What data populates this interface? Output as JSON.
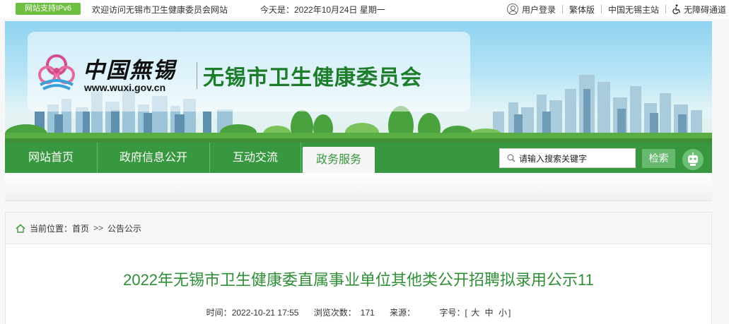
{
  "topbar": {
    "ipv6_badge": "网站支持IPv6",
    "welcome": "欢迎访问无锡市卫生健康委员会网站",
    "today": "今天是：2022年10月24日  星期一",
    "links": {
      "login": "用户登录",
      "traditional": "繁体版",
      "main_site": "中国无锡主站",
      "accessibility": "无障碍通道"
    }
  },
  "banner": {
    "logo_text": "中国無锡",
    "logo_url": "www.wuxi.gov.cn",
    "site_title": "无锡市卫生健康委员会"
  },
  "nav": {
    "items": [
      "网站首页",
      "政府信息公开",
      "互动交流",
      "政务服务"
    ],
    "active": "政务服务",
    "search_placeholder": "请输入搜索关键字",
    "search_button": "检索"
  },
  "breadcrumb": {
    "label": "当前位置：",
    "home": "首页",
    "separator": ">>",
    "current": "公告公示"
  },
  "article": {
    "title": "2022年无锡市卫生健康委直属事业单位其他类公开招聘拟录用公示11",
    "time_label": "时间：",
    "time": "2022-10-21 17:55",
    "views_label": "浏览次数：",
    "views": "171",
    "source_label": "来源：",
    "font_label": "字号：",
    "font_open": "[",
    "font_large": "大",
    "font_medium": "中",
    "font_small": "小",
    "font_close": "]"
  },
  "colors": {
    "brand_green": "#37983f",
    "title_green": "#2f8f36",
    "ipv6_green": "#6cbf3f"
  }
}
